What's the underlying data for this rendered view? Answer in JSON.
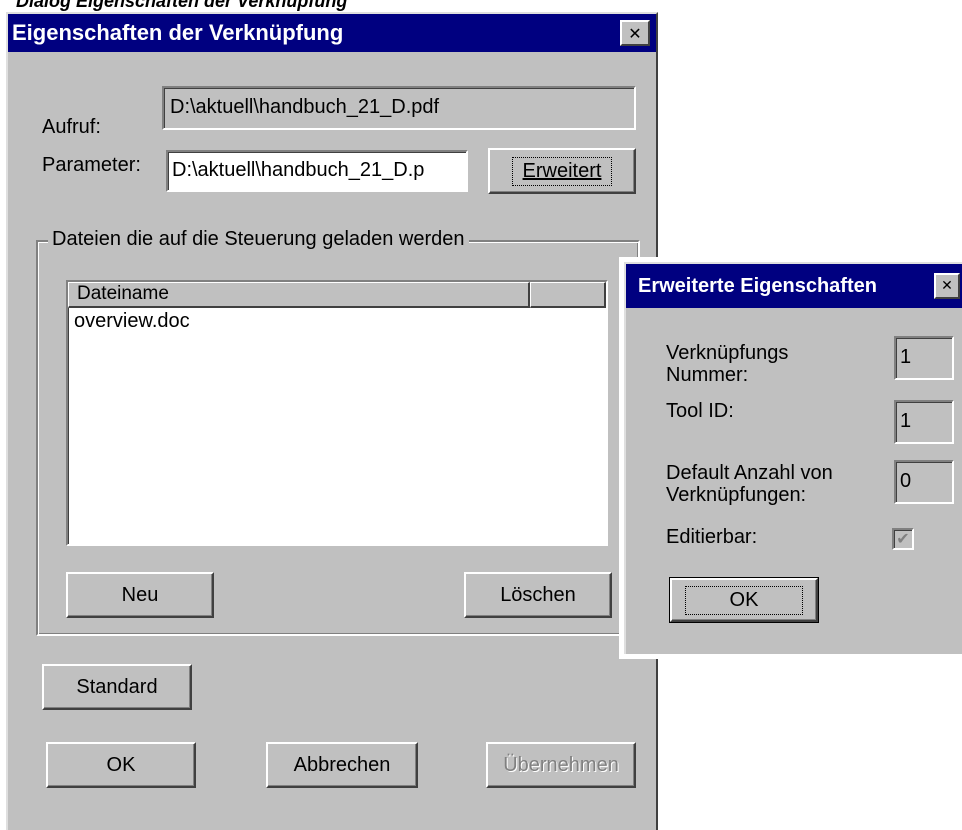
{
  "page_caption": "Dialog Eigenschaften der Verknüpfung",
  "main_dialog": {
    "title": "Eigenschaften der Verknüpfung",
    "close_glyph": "✕",
    "aufruf_label": "Aufruf:",
    "aufruf_value": "D:\\aktuell\\handbuch_21_D.pdf",
    "parameter_label": "Parameter:",
    "parameter_value": "D:\\aktuell\\handbuch_21_D.p",
    "erweitert_button": "Erweitert",
    "group_title": "Dateien die auf die Steuerung geladen werden",
    "list": {
      "columns": [
        "Dateiname",
        ""
      ],
      "rows": [
        "overview.doc"
      ]
    },
    "neu_button": "Neu",
    "loeschen_button": "Löschen",
    "standard_button": "Standard",
    "ok_button": "OK",
    "abbrechen_button": "Abbrechen",
    "uebernehmen_button": "Übernehmen"
  },
  "ext_dialog": {
    "title": "Erweiterte Eigenschaften",
    "close_glyph": "✕",
    "verknuepfungs_nummer_label_1": "Verknüpfungs",
    "verknuepfungs_nummer_label_2": "Nummer:",
    "verknuepfungs_nummer_value": "1",
    "tool_id_label": "Tool ID:",
    "tool_id_value": "1",
    "default_anzahl_label_1": "Default Anzahl von",
    "default_anzahl_label_2": "Verknüpfungen:",
    "default_anzahl_value": "0",
    "editierbar_label": "Editierbar:",
    "editierbar_checked_glyph": "✔",
    "ok_button": "OK"
  }
}
